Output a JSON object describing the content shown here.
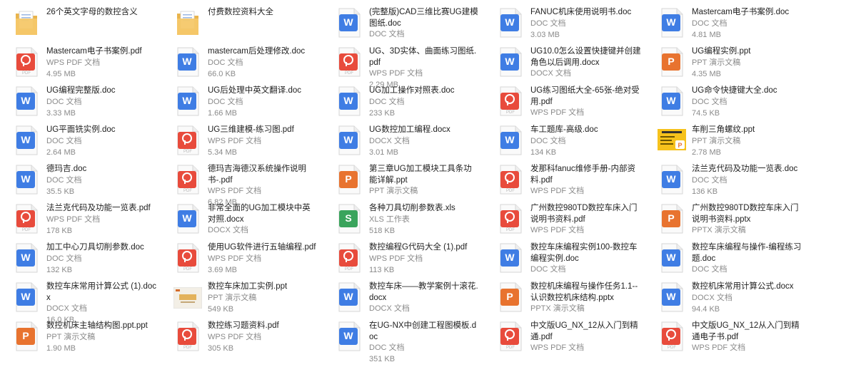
{
  "colors": {
    "doc_blue": "#3f7de4",
    "pdf_red": "#e84b3c",
    "ppt_orange": "#e8732f",
    "xls_green": "#3aa45c",
    "folder_yellow": "#f5c869"
  },
  "files": [
    [
      {
        "name": "26个英文字母的数控含义",
        "kind": "folder",
        "icon": "folder-icon"
      },
      {
        "name": "Mastercam电子书案例.pdf",
        "kind": "pdf",
        "type": "WPS PDF 文档",
        "size": "4.95 MB",
        "icon": "pdf-icon"
      },
      {
        "name": "UG编程完整版.doc",
        "kind": "doc",
        "type": "DOC 文档",
        "size": "3.33 MB",
        "icon": "doc-icon"
      },
      {
        "name": "UG平面铣实例.doc",
        "kind": "doc",
        "type": "DOC 文档",
        "size": "2.64 MB",
        "icon": "doc-icon"
      },
      {
        "name": "德玛吉.doc",
        "kind": "doc",
        "type": "DOC 文档",
        "size": "35.5 KB",
        "icon": "doc-icon"
      },
      {
        "name": "法兰克代码及功能一览表.pdf",
        "kind": "pdf",
        "type": "WPS PDF 文档",
        "size": "178 KB",
        "icon": "pdf-icon"
      },
      {
        "name": "加工中心刀具切削参数.doc",
        "kind": "doc",
        "type": "DOC 文档",
        "size": "132 KB",
        "icon": "doc-icon"
      },
      {
        "name": "数控车床常用计算公式 (1).docx",
        "kind": "doc",
        "type": "DOCX 文档",
        "size": "16.0 KB",
        "icon": "doc-icon"
      },
      {
        "name": "数控机床主轴结构图.ppt.ppt",
        "kind": "ppt",
        "type": "PPT 演示文稿",
        "size": "1.90 MB",
        "icon": "ppt-icon"
      }
    ],
    [
      {
        "name": "付费数控资料大全",
        "kind": "folder",
        "icon": "folder-icon"
      },
      {
        "name": "mastercam后处理修改.doc",
        "kind": "doc",
        "type": "DOC 文档",
        "size": "66.0 KB",
        "icon": "doc-icon"
      },
      {
        "name": "UG后处理中英文翻译.doc",
        "kind": "doc",
        "type": "DOC 文档",
        "size": "1.66 MB",
        "icon": "doc-icon"
      },
      {
        "name": "UG三维建模-练习图.pdf",
        "kind": "pdf",
        "type": "WPS PDF 文档",
        "size": "5.34 MB",
        "icon": "pdf-icon"
      },
      {
        "name": "德玛吉海德汉系统操作说明书-.pdf",
        "kind": "pdf",
        "type": "WPS PDF 文档",
        "size": "6.82 MB",
        "icon": "pdf-icon"
      },
      {
        "name": "非常全面的UG加工模块中英对照.docx",
        "kind": "doc",
        "type": "DOCX 文档",
        "size": "",
        "icon": "doc-icon"
      },
      {
        "name": "使用UG软件进行五轴编程.pdf",
        "kind": "pdf",
        "type": "WPS PDF 文档",
        "size": "3.69 MB",
        "icon": "pdf-icon"
      },
      {
        "name": "数控车床加工实例.ppt",
        "kind": "thumb-ppt",
        "type": "PPT 演示文稿",
        "size": "549 KB",
        "icon": "ppt-thumbnail-icon"
      },
      {
        "name": "数控练习题资料.pdf",
        "kind": "pdf",
        "type": "WPS PDF 文档",
        "size": "305 KB",
        "icon": "pdf-icon"
      }
    ],
    [
      {
        "name": "(完整版)CAD三维比赛UG建模图纸.doc",
        "kind": "doc",
        "type": "DOC 文档",
        "size": "",
        "icon": "doc-icon"
      },
      {
        "name": "UG、3D实体、曲面练习图纸.pdf",
        "kind": "pdf",
        "type": "WPS PDF 文档",
        "size": "2.29 MB",
        "icon": "pdf-icon"
      },
      {
        "name": "UG加工操作对照表.doc",
        "kind": "doc",
        "type": "DOC 文档",
        "size": "233 KB",
        "icon": "doc-icon"
      },
      {
        "name": "UG数控加工编程.docx",
        "kind": "doc",
        "type": "DOCX 文档",
        "size": "3.01 MB",
        "icon": "doc-icon"
      },
      {
        "name": "第三章UG加工模块工具条功能详解.ppt",
        "kind": "ppt",
        "type": "PPT 演示文稿",
        "size": "",
        "icon": "ppt-icon"
      },
      {
        "name": "各种刀具切削参数表.xls",
        "kind": "xls",
        "type": "XLS 工作表",
        "size": "518 KB",
        "icon": "xls-icon"
      },
      {
        "name": "数控编程G代码大全 (1).pdf",
        "kind": "pdf",
        "type": "WPS PDF 文档",
        "size": "113 KB",
        "icon": "pdf-icon"
      },
      {
        "name": "数控车床——教学案例十滚花.docx",
        "kind": "doc",
        "type": "DOCX 文档",
        "size": "",
        "icon": "doc-icon"
      },
      {
        "name": "在UG-NX中创建工程图模板.doc",
        "kind": "doc",
        "type": "DOC 文档",
        "size": "351 KB",
        "icon": "doc-icon"
      }
    ],
    [
      {
        "name": "FANUC机床使用说明书.doc",
        "kind": "doc",
        "type": "DOC 文档",
        "size": "3.03 MB",
        "icon": "doc-icon"
      },
      {
        "name": "UG10.0怎么设置快捷键并创建角色以后调用.docx",
        "kind": "doc",
        "type": "DOCX 文档",
        "size": "",
        "icon": "doc-icon"
      },
      {
        "name": "UG练习图纸大全-65张-绝对受用.pdf",
        "kind": "pdf",
        "type": "WPS PDF 文档",
        "size": "",
        "icon": "pdf-icon"
      },
      {
        "name": "车工题库-高级.doc",
        "kind": "doc",
        "type": "DOC 文档",
        "size": "134 KB",
        "icon": "doc-icon"
      },
      {
        "name": "发那科fanuc维修手册-内部资料.pdf",
        "kind": "pdf",
        "type": "WPS PDF 文档",
        "size": "",
        "icon": "pdf-icon"
      },
      {
        "name": "广州数控980TD数控车床入门说明书资料.pdf",
        "kind": "pdf",
        "type": "WPS PDF 文档",
        "size": "",
        "icon": "pdf-icon"
      },
      {
        "name": "数控车床编程实例100-数控车编程实例.doc",
        "kind": "doc",
        "type": "DOC 文档",
        "size": "",
        "icon": "doc-icon"
      },
      {
        "name": "数控机床编程与操作任务1.1--认识数控机床结构.pptx",
        "kind": "ppt",
        "type": "PPTX 演示文稿",
        "size": "",
        "icon": "ppt-icon"
      },
      {
        "name": "中文版UG_NX_12从入门到精通.pdf",
        "kind": "pdf",
        "type": "WPS PDF 文档",
        "size": "",
        "icon": "pdf-icon"
      }
    ],
    [
      {
        "name": "Mastercam电子书案例.doc",
        "kind": "doc",
        "type": "DOC 文档",
        "size": "4.81 MB",
        "icon": "doc-icon"
      },
      {
        "name": "UG编程实例.ppt",
        "kind": "ppt",
        "type": "PPT 演示文稿",
        "size": "4.35 MB",
        "icon": "ppt-icon"
      },
      {
        "name": "UG命令快捷键大全.doc",
        "kind": "doc",
        "type": "DOC 文档",
        "size": "74.5 KB",
        "icon": "doc-icon"
      },
      {
        "name": "车削三角螺纹.ppt",
        "kind": "thumb-yellow",
        "type": "PPT 演示文稿",
        "size": "2.78 MB",
        "icon": "ppt-thumbnail-icon"
      },
      {
        "name": "法兰克代码及功能一览表.doc",
        "kind": "doc",
        "type": "DOC 文档",
        "size": "136 KB",
        "icon": "doc-icon"
      },
      {
        "name": "广州数控980TD数控车床入门说明书资料.pptx",
        "kind": "ppt",
        "type": "PPTX 演示文稿",
        "size": "",
        "icon": "ppt-icon"
      },
      {
        "name": "数控车床编程与操作-编程练习题.doc",
        "kind": "doc",
        "type": "DOC 文档",
        "size": "",
        "icon": "doc-icon"
      },
      {
        "name": "数控机床常用计算公式.docx",
        "kind": "doc",
        "type": "DOCX 文档",
        "size": "94.4 KB",
        "icon": "doc-icon"
      },
      {
        "name": "中文版UG_NX_12从入门到精通电子书.pdf",
        "kind": "pdf",
        "type": "WPS PDF 文档",
        "size": "",
        "icon": "pdf-icon"
      }
    ]
  ]
}
